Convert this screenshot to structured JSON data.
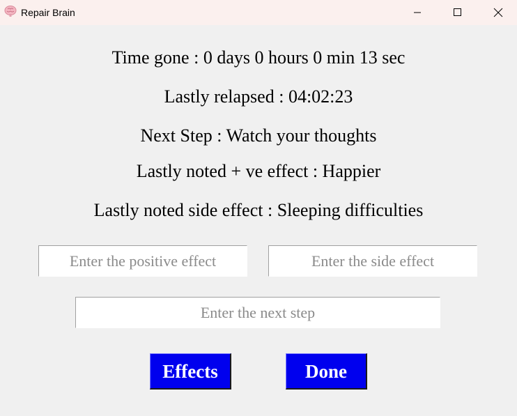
{
  "window": {
    "title": "Repair Brain",
    "icon": "brain-icon",
    "controls": [
      "minimize-icon",
      "maximize-icon",
      "close-icon"
    ]
  },
  "status": {
    "time_gone": "Time gone : 0 days 0 hours 0 min 13 sec",
    "last_relapse": "Lastly relapsed : 04:02:23",
    "next_step": "Next Step : Watch your thoughts",
    "positive_effect": "Lastly noted + ve effect : Happier",
    "side_effect": "Lastly noted side effect : Sleeping difficulties"
  },
  "inputs": {
    "positive_placeholder": "Enter the positive effect",
    "positive_value": "",
    "side_placeholder": "Enter the side effect",
    "side_value": "",
    "next_step_placeholder": "Enter the next step",
    "next_step_value": ""
  },
  "buttons": {
    "effects_label": "Effects",
    "done_label": "Done"
  },
  "colors": {
    "button_bg": "#0000ee",
    "button_text": "#ffffff",
    "window_bg": "#f0f0f0",
    "titlebar_bg": "#fbf0ee"
  }
}
